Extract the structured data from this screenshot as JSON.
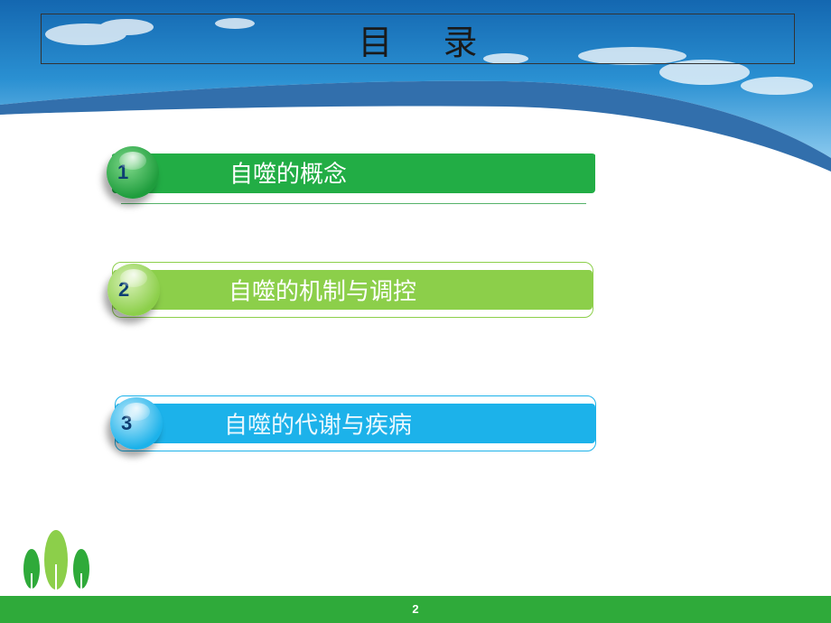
{
  "title": "目 录",
  "items": [
    {
      "number": "1",
      "label": "自噬的概念"
    },
    {
      "number": "2",
      "label": "自噬的机制与调控"
    },
    {
      "number": "3",
      "label": "自噬的代谢与疾病"
    }
  ],
  "page_number": "2",
  "colors": {
    "item1": "#22ad45",
    "item2": "#8ccf4a",
    "item3": "#1cb2ea",
    "sky_top": "#1b7fc2",
    "footer": "#2faa3a"
  }
}
